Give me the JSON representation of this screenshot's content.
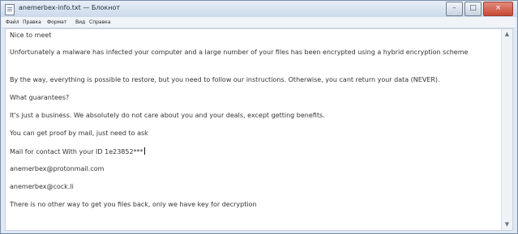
{
  "window": {
    "title": "anemerbex-info.txt — Блокнот",
    "minimize": "–",
    "maximize": "□",
    "close": "×"
  },
  "menu": [
    "Файл",
    "Правка",
    "Формат",
    "Вид",
    "Справка"
  ],
  "document": {
    "lines": [
      "Nice to meet",
      "Unfortunately a malware has infected your computer and a large number of your files has been encrypted using a hybrid encryption scheme",
      "By the way, everything is possible to restore, but you need to follow our instructions. Otherwise, you cant return your data (NEVER).",
      "What guarantees?",
      "It's just a business. We absolutely do not care about you and your deals, except getting benefits.",
      "You can get proof by mail, just need to ask",
      "Mail for contact With your ID 1e23852***",
      "anemerbex@protonmail.com",
      "anemerbex@cock.li",
      "There is no other way to get you files back, only we have key for decryption"
    ]
  },
  "scrollbar": {
    "up_arrow": "▲",
    "down_arrow": "▼"
  }
}
